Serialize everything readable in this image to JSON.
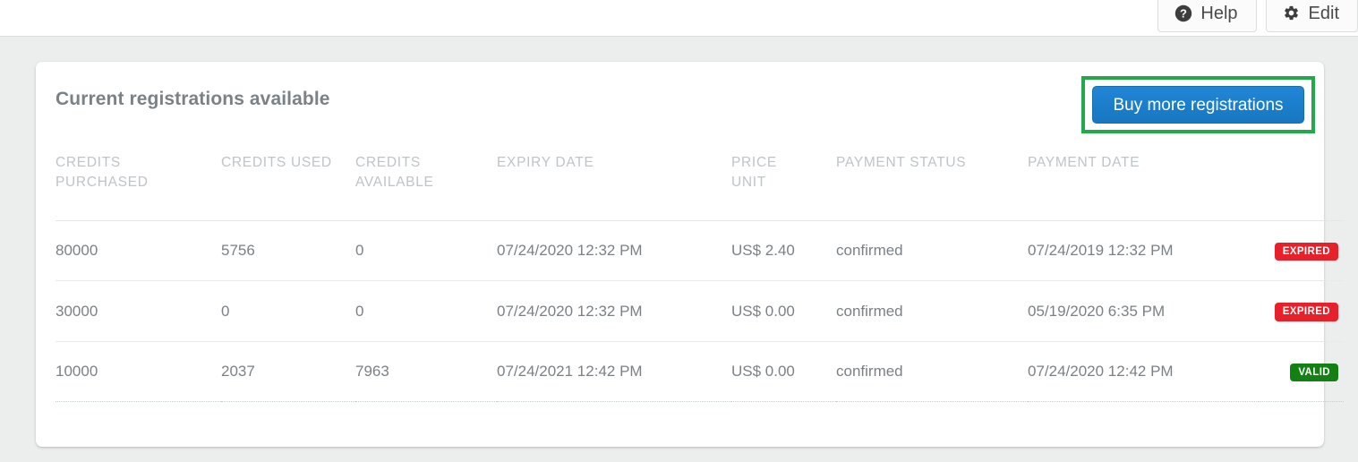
{
  "topbar": {
    "buttons": [
      {
        "label": "Help",
        "icon": "question-circle-icon"
      },
      {
        "label": "Edit",
        "icon": "gear-icon"
      }
    ]
  },
  "card": {
    "title": "Current registrations available",
    "buy_button_label": "Buy more registrations",
    "highlight_color": "#23a94b",
    "buy_button_color": "#1b7dcc"
  },
  "table": {
    "headers": [
      "CREDITS\nPURCHASED",
      "CREDITS USED",
      "CREDITS\nAVAILABLE",
      "EXPIRY DATE",
      "PRICE\nUNIT",
      "PAYMENT STATUS",
      "PAYMENT DATE",
      ""
    ],
    "rows": [
      {
        "credits_purchased": "80000",
        "credits_used": "5756",
        "credits_available": "0",
        "expiry_date": "07/24/2020 12:32 PM",
        "price_unit": "US$ 2.40",
        "payment_status": "confirmed",
        "payment_date": "07/24/2019 12:32 PM",
        "status_badge": "EXPIRED",
        "status_color": "#e8202a"
      },
      {
        "credits_purchased": "30000",
        "credits_used": "0",
        "credits_available": "0",
        "expiry_date": "07/24/2020 12:32 PM",
        "price_unit": "US$ 0.00",
        "payment_status": "confirmed",
        "payment_date": "05/19/2020 6:35 PM",
        "status_badge": "EXPIRED",
        "status_color": "#e8202a"
      },
      {
        "credits_purchased": "10000",
        "credits_used": "2037",
        "credits_available": "7963",
        "expiry_date": "07/24/2021 12:42 PM",
        "price_unit": "US$ 0.00",
        "payment_status": "confirmed",
        "payment_date": "07/24/2020 12:42 PM",
        "status_badge": "VALID",
        "status_color": "#128012"
      }
    ]
  }
}
